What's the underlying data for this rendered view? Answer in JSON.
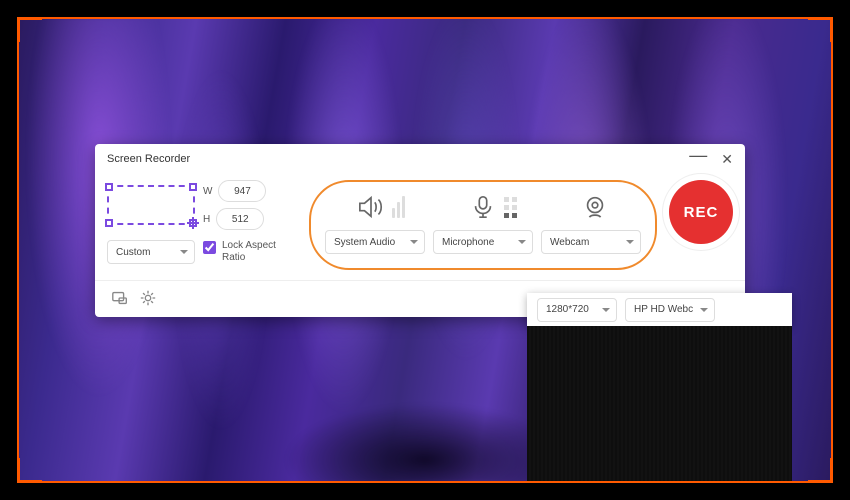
{
  "window": {
    "title": "Screen Recorder"
  },
  "dimensions": {
    "width_label": "W",
    "height_label": "H",
    "width": "947",
    "height": "512",
    "preset": "Custom",
    "lock_aspect": true,
    "lock_label": "Lock Aspect Ratio"
  },
  "sources": {
    "audio_select": "System Audio",
    "mic_select": "Microphone",
    "webcam_select": "Webcam"
  },
  "record": {
    "label": "REC"
  },
  "webcam_panel": {
    "resolution": "1280*720",
    "device": "HP HD Webc"
  },
  "colors": {
    "accent": "#7b4ae0",
    "capture_frame": "#ff5a00",
    "source_ring": "#f08a2c",
    "rec": "#e53030"
  }
}
